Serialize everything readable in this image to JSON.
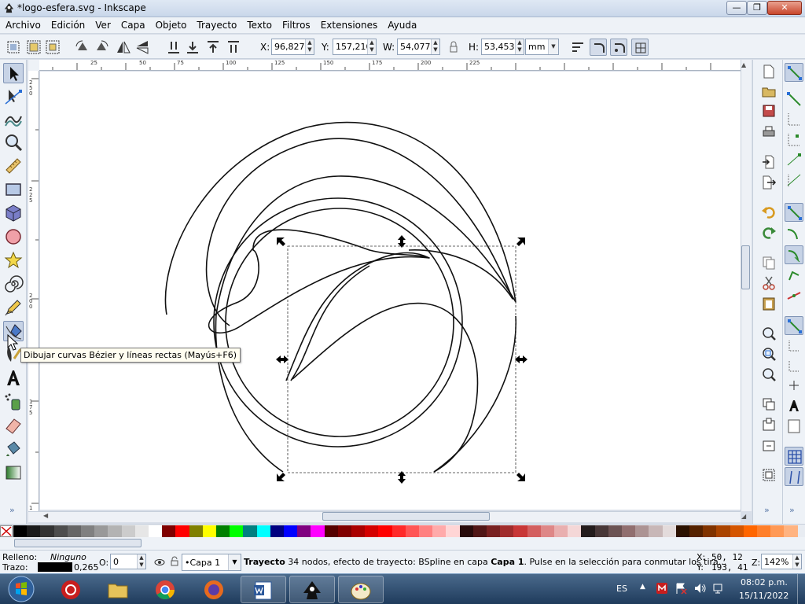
{
  "window": {
    "title": "*logo-esfera.svg - Inkscape",
    "close_glyph": "✕",
    "min_glyph": "—",
    "max_glyph": "❐"
  },
  "menu": [
    "Archivo",
    "Edición",
    "Ver",
    "Capa",
    "Objeto",
    "Trayecto",
    "Texto",
    "Filtros",
    "Extensiones",
    "Ayuda"
  ],
  "controls": {
    "x_label": "X:",
    "x_value": "96,827",
    "y_label": "Y:",
    "y_value": "157,210",
    "w_label": "W:",
    "w_value": "54,077",
    "h_label": "H:",
    "h_value": "53,453",
    "unit": "mm"
  },
  "rulers": {
    "top_labels": [
      "25",
      "50",
      "75",
      "100",
      "125",
      "150",
      "175",
      "200",
      "225"
    ],
    "left_labels": [
      "2 5 0",
      "2 2 5",
      "2 0 0",
      "1 7 5",
      "1"
    ]
  },
  "tooltip": "Dibujar curvas Bézier y líneas rectas (Mayús+F6)",
  "palette": {
    "colors": [
      "#000000",
      "#1a1a1a",
      "#333333",
      "#4d4d4d",
      "#666666",
      "#808080",
      "#999999",
      "#b3b3b3",
      "#cccccc",
      "#e6e6e6",
      "#ffffff",
      "#800000",
      "#ff0000",
      "#808000",
      "#ffff00",
      "#008000",
      "#00ff00",
      "#008080",
      "#00ffff",
      "#000080",
      "#0000ff",
      "#800080",
      "#ff00ff",
      "#550000",
      "#800000",
      "#aa0000",
      "#d40000",
      "#ff0000",
      "#ff2a2a",
      "#ff5555",
      "#ff8080",
      "#ffaaaa",
      "#ffd5d5",
      "#280b0b",
      "#501616",
      "#782121",
      "#a02c2c",
      "#c83737",
      "#d35f5f",
      "#de8787",
      "#e9afaf",
      "#f4d7d7",
      "#241c1c",
      "#483737",
      "#6c5353",
      "#916f6f",
      "#ac9393",
      "#c8b7b7",
      "#e3dbdb",
      "#2b1100",
      "#552200",
      "#803300",
      "#aa4400",
      "#d45500",
      "#ff6600",
      "#ff7f2a",
      "#ff9955",
      "#ffb380"
    ]
  },
  "status": {
    "fill_label": "Relleno:",
    "fill_value": "Ninguno",
    "stroke_label": "Trazo:",
    "stroke_width": "0,265",
    "opacity_label": "O:",
    "opacity_value": "0",
    "layer": "•Capa 1",
    "message_bold1": "Trayecto",
    "message_part1": " 34 nodos, efecto de trayecto: BSpline en capa ",
    "message_bold2": "Capa 1",
    "message_part2": ". Pulse en la selección para conmutar los tira...",
    "cursor_x_label": "X:",
    "cursor_x": "50, 12",
    "cursor_y_label": "Y:",
    "cursor_y": "193, 41",
    "zoom_label": "Z:",
    "zoom": "142%"
  },
  "taskbar": {
    "language": "ES",
    "time": "08:02 p.m.",
    "date": "15/11/2022"
  }
}
